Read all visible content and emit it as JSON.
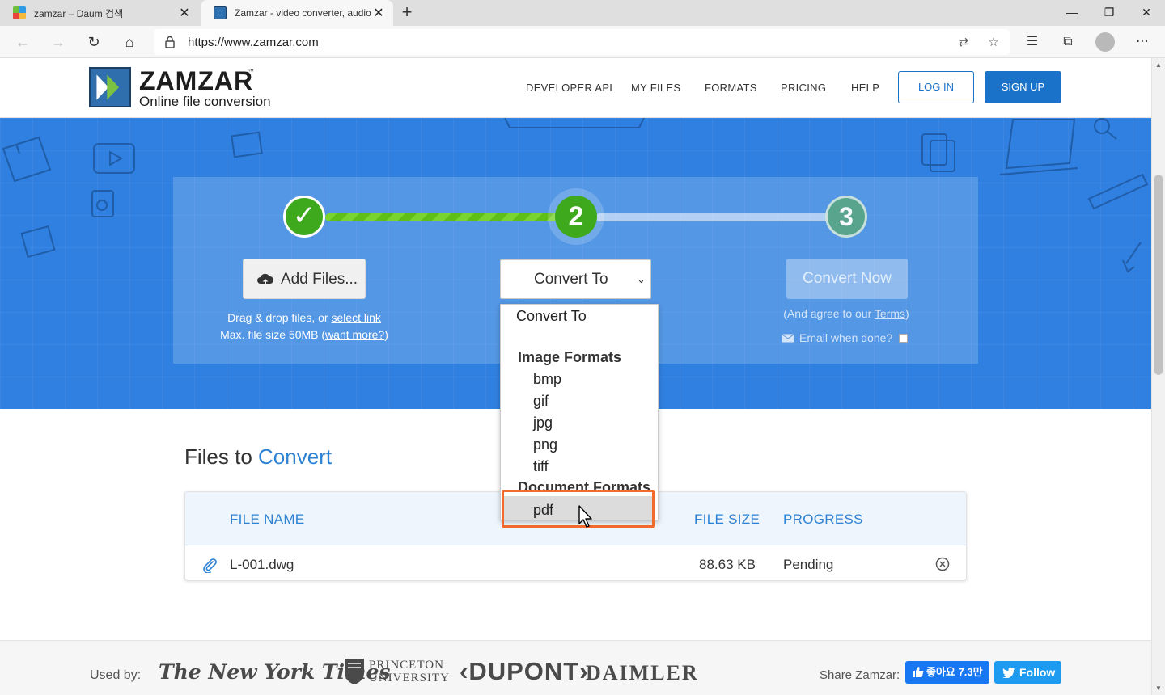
{
  "browser": {
    "tabs": [
      {
        "title": "zamzar – Daum 검색",
        "icon": "daum-favicon"
      },
      {
        "title": "Zamzar - video converter, audio",
        "icon": "zamzar-favicon"
      }
    ],
    "new_tab": "+",
    "url": "https://www.zamzar.com",
    "window": {
      "minimize": "—",
      "restore": "❐",
      "close": "✕"
    }
  },
  "site": {
    "logo": {
      "name": "ZAMZAR",
      "tm": "™",
      "tagline": "Online file conversion"
    },
    "nav": [
      "DEVELOPER API",
      "MY FILES",
      "FORMATS",
      "PRICING",
      "HELP"
    ],
    "login": "LOG IN",
    "signup": "SIGN UP"
  },
  "converter": {
    "steps": [
      "✓",
      "2",
      "3"
    ],
    "add_files": "Add Files...",
    "drag_text": "Drag & drop files, or ",
    "select_link": "select link",
    "max_size_text": "Max. file size 50MB (",
    "want_more": "want more?",
    "close_paren": ")",
    "convert_to": "Convert To",
    "convert_now": "Convert Now",
    "agree_prefix": "(And agree to our ",
    "terms": "Terms",
    "agree_suffix": ")",
    "email_when_done": "Email when done?"
  },
  "dropdown": {
    "placeholder": "Convert To",
    "groups": [
      {
        "label": "Image Formats",
        "options": [
          "bmp",
          "gif",
          "jpg",
          "png",
          "tiff"
        ]
      },
      {
        "label": "Document Formats",
        "options": [
          "pdf"
        ]
      }
    ],
    "highlighted": "pdf"
  },
  "files": {
    "title": "Files to ",
    "title_accent": "Convert",
    "columns": {
      "name": "FILE NAME",
      "size": "FILE SIZE",
      "progress": "PROGRESS"
    },
    "rows": [
      {
        "name": "L-001.dwg",
        "size": "88.63 KB",
        "progress": "Pending"
      }
    ]
  },
  "footer": {
    "used_by": "Used by:",
    "brands": {
      "nyt": "The New York Times",
      "princeton_1": "PRINCETON",
      "princeton_2": "UNIVERSITY",
      "dupont": "‹DUPONT›",
      "daimler": "DAIMLER"
    },
    "share": "Share Zamzar:",
    "fb_like": "좋아요 7.3만",
    "tw_follow": "Follow"
  },
  "colors": {
    "hero_blue": "#2f80e0",
    "brand_blue": "#1a73c8",
    "step_green": "#3ea91c",
    "highlight_orange": "#f26b2c"
  }
}
